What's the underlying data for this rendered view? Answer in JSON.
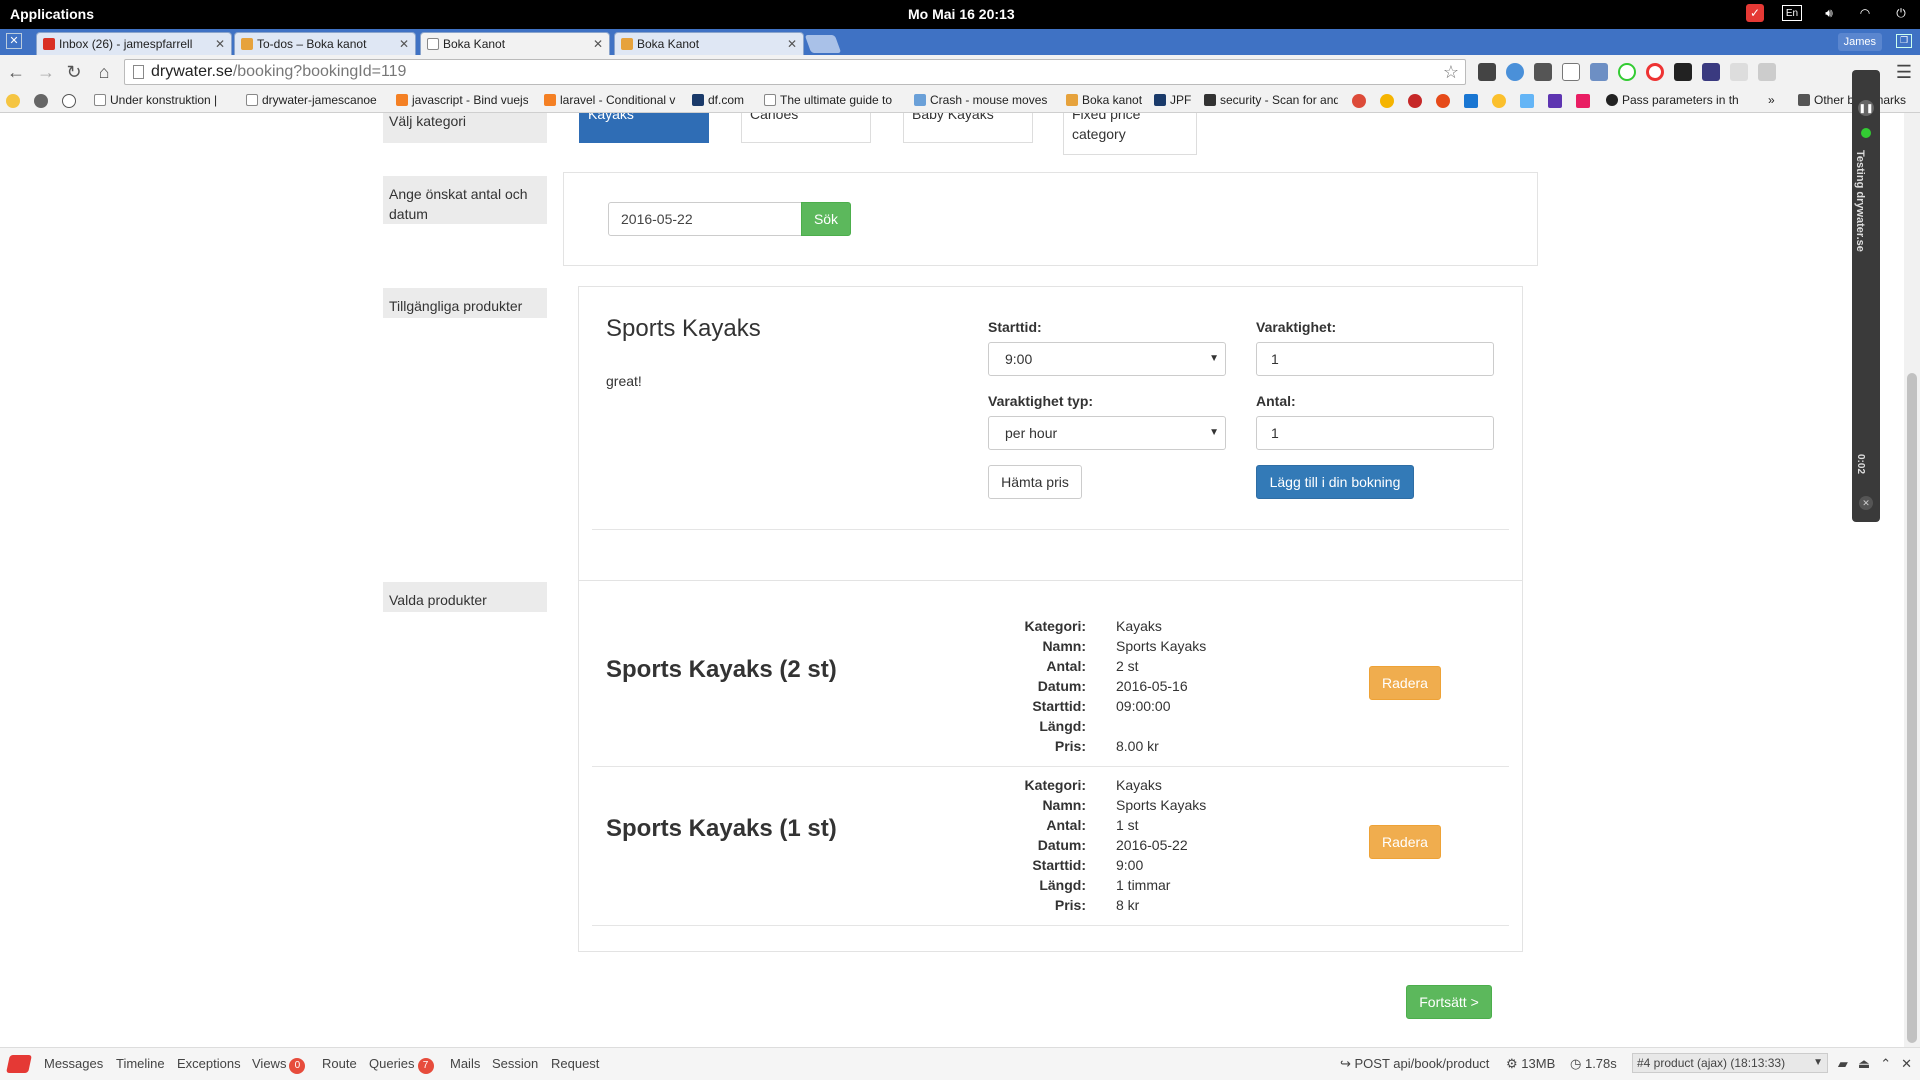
{
  "os": {
    "applications": "Applications",
    "clock": "Mo Mai 16   20:13",
    "lang": "En"
  },
  "browser": {
    "tabs": [
      {
        "label": "Inbox (26) - jamespfarrell",
        "favicon_color": "#d93025"
      },
      {
        "label": "To-dos – Boka kanot",
        "favicon_color": "#e6a23c"
      },
      {
        "label": "Boka Kanot",
        "favicon_color": "#9e9e9e"
      },
      {
        "label": "Boka Kanot",
        "favicon_color": "#e6a23c"
      }
    ],
    "profile": "James",
    "url_host": "drywater.se",
    "url_path": "/booking?bookingId=119",
    "bookmarks": [
      {
        "label": "Under konstruktion |"
      },
      {
        "label": "drywater-jamescanoe"
      },
      {
        "label": "javascript - Bind vuejs"
      },
      {
        "label": "laravel - Conditional v"
      },
      {
        "label": "df.com"
      },
      {
        "label": "The ultimate guide to"
      },
      {
        "label": "Crash - mouse moves"
      },
      {
        "label": "Boka kanot"
      },
      {
        "label": "JPF"
      },
      {
        "label": "security - Scan for and"
      },
      {
        "label": "Pass parameters in th"
      },
      {
        "label": "Other bookmarks"
      }
    ]
  },
  "page": {
    "category_label": "Välj kategori",
    "categories": [
      "Kayaks",
      "Canoes",
      "Baby Kayaks",
      "Fixed price category"
    ],
    "search_label": "Ange önskat antal och datum",
    "search_date": "2016-05-22",
    "search_button": "Sök",
    "available_label": "Tillgängliga produkter",
    "product": {
      "title": "Sports Kayaks",
      "description": "great!",
      "start_label": "Starttid:",
      "start_value": "9:00",
      "duration_label": "Varaktighet:",
      "duration_value": "1",
      "duration_type_label": "Varaktighet typ:",
      "duration_type_value": "per hour",
      "quantity_label": "Antal:",
      "quantity_value": "1",
      "price_button": "Hämta pris",
      "add_button": "Lägg till i din bokning"
    },
    "selected_label": "Valda produkter",
    "selected": [
      {
        "title": "Sports Kayaks (2 st)",
        "fields": [
          {
            "k": "Kategori:",
            "v": "Kayaks"
          },
          {
            "k": "Namn:",
            "v": "Sports Kayaks"
          },
          {
            "k": "Antal:",
            "v": "2 st"
          },
          {
            "k": "Datum:",
            "v": "2016-05-16"
          },
          {
            "k": "Starttid:",
            "v": "09:00:00"
          },
          {
            "k": "Längd:",
            "v": ""
          },
          {
            "k": "Pris:",
            "v": "8.00 kr"
          }
        ],
        "delete_button": "Radera"
      },
      {
        "title": "Sports Kayaks (1 st)",
        "fields": [
          {
            "k": "Kategori:",
            "v": "Kayaks"
          },
          {
            "k": "Namn:",
            "v": "Sports Kayaks"
          },
          {
            "k": "Antal:",
            "v": "1 st"
          },
          {
            "k": "Datum:",
            "v": "2016-05-22"
          },
          {
            "k": "Starttid:",
            "v": "9:00"
          },
          {
            "k": "Längd:",
            "v": "1 timmar"
          },
          {
            "k": "Pris:",
            "v": "8 kr"
          }
        ],
        "delete_button": "Radera"
      }
    ],
    "continue_button": "Fortsätt >"
  },
  "recorder": {
    "title": "Testing drywater.se",
    "time": "0:02"
  },
  "debugbar": {
    "tabs": [
      "Messages",
      "Timeline",
      "Exceptions",
      "Views",
      "Route",
      "Queries",
      "Mails",
      "Session",
      "Request"
    ],
    "views_count": "0",
    "queries_count": "7",
    "request": "POST api/book/product",
    "memory": "13MB",
    "time": "1.78s",
    "selected_request": "#4 product (ajax) (18:13:33)"
  }
}
